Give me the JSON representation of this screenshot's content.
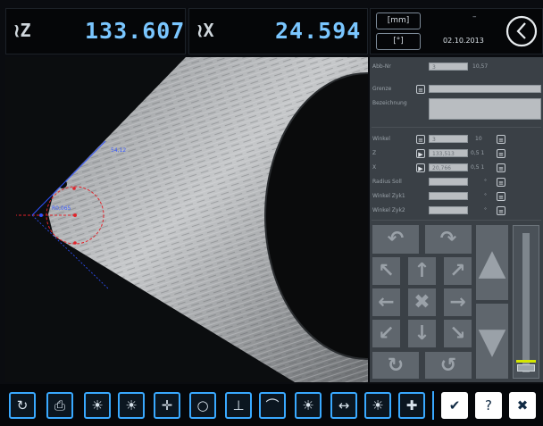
{
  "readouts": {
    "z": {
      "label": "≀Z",
      "value": "133.607"
    },
    "x": {
      "label": "≀X",
      "value": "24.594"
    }
  },
  "unit_buttons": [
    "[mm]",
    "[°]"
  ],
  "status": {
    "dash": "–",
    "date": "02.10.2013"
  },
  "camera": {
    "measurement_labels": [
      "54,12",
      "R0,065"
    ]
  },
  "form": {
    "fields": [
      {
        "label": "Abb-Nr",
        "value": "3",
        "suffix": "10,57"
      },
      {
        "label": "Grenze",
        "value": "",
        "suffix": ""
      },
      {
        "label": "Bezeichnung",
        "value": "",
        "suffix": ""
      },
      {
        "label": "Winkel",
        "value": "3",
        "suffix": "10"
      },
      {
        "label": "Z",
        "value": "133,513",
        "suffix": "0,5 1"
      },
      {
        "label": "X",
        "value": "20,766",
        "suffix": "0,5 1"
      },
      {
        "label": "Radius Soll",
        "value": "",
        "suffix": "°"
      },
      {
        "label": "Winkel Zyk1",
        "value": "",
        "suffix": "°"
      },
      {
        "label": "Winkel Zyk2",
        "value": "",
        "suffix": "°"
      }
    ]
  },
  "jog": {
    "keys": [
      "↶",
      "↷",
      "↖",
      "↑",
      "↗",
      "←",
      "✖",
      "→",
      "↙",
      "↓",
      "↘",
      "↻",
      "↺"
    ],
    "big_up": "▲",
    "big_down": "▼"
  },
  "toolbar": {
    "icons": [
      "refresh-icon",
      "print-icon",
      "light-1-icon",
      "light-2-icon",
      "crosshair-icon",
      "circle-measure-icon",
      "edge-icon",
      "lamp-icon",
      "light-3-icon",
      "move-icon",
      "light-4-icon",
      "plus-icon",
      "confirm-icon",
      "help-icon",
      "close-icon"
    ],
    "glyphs": [
      "↻",
      "⎙",
      "☀",
      "☀",
      "✛",
      "○",
      "⊥",
      "⌒",
      "☀",
      "↔",
      "☀",
      "✚",
      "✔",
      "?",
      "✖"
    ]
  },
  "colors": {
    "accent": "#39a9ff",
    "readout": "#7ac6ff",
    "overlay_red": "#e0242b",
    "overlay_blue": "#2f52ff"
  }
}
